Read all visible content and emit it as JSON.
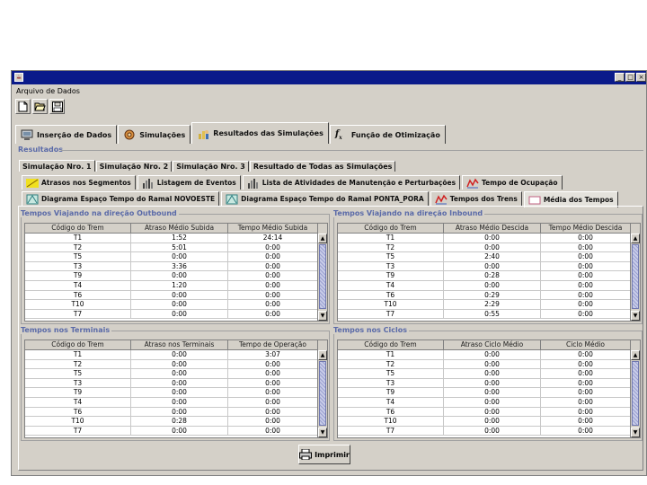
{
  "window": {
    "title": ""
  },
  "menu": {
    "items": [
      "Arquivo de Dados"
    ]
  },
  "toolbar": {
    "icons": [
      "new-file-icon",
      "open-folder-icon",
      "save-disk-icon"
    ]
  },
  "main_tabs": [
    {
      "label": "Inserção de Dados",
      "icon": "monitor-icon"
    },
    {
      "label": "Simulações",
      "icon": "gear-icon"
    },
    {
      "label": "Resultados das Simulações",
      "icon": "people-chart-icon",
      "active": true
    },
    {
      "label": "Função de Otimização",
      "icon": "function-icon"
    }
  ],
  "results_section": "Resultados",
  "sim_tabs": [
    {
      "label": "Simulação Nro. 1",
      "active": true
    },
    {
      "label": "Simulação Nro. 2"
    },
    {
      "label": "Simulação Nro. 3"
    },
    {
      "label": "Resultado de Todas as Simulações"
    }
  ],
  "result_tabs_row1": [
    {
      "label": "Atrasos nos Segmentos",
      "icon": "segment-icon"
    },
    {
      "label": "Listagem de Eventos",
      "icon": "bars-icon"
    },
    {
      "label": "Lista de Atividades de Manutenção e Perturbações",
      "icon": "bars-icon"
    },
    {
      "label": "Tempo de Ocupação",
      "icon": "line-chart-icon"
    }
  ],
  "result_tabs_row2": [
    {
      "label": "Diagrama Espaço Tempo do Ramal NOVOESTE",
      "icon": "diagram-icon"
    },
    {
      "label": "Diagrama Espaço Tempo do Ramal PONTA_PORA",
      "icon": "diagram-icon"
    },
    {
      "label": "Tempos dos Trens",
      "icon": "line-chart-icon"
    },
    {
      "label": "Média dos Tempos",
      "icon": "blank-icon",
      "active": true
    }
  ],
  "panels": {
    "outbound": {
      "title": "Tempos Viajando na direção Outbound",
      "columns": [
        "Código do Trem",
        "Atraso Médio Subida",
        "Tempo Médio Subida"
      ],
      "rows": [
        [
          "T1",
          "1:52",
          "24:14"
        ],
        [
          "T2",
          "5:01",
          "0:00"
        ],
        [
          "T5",
          "0:00",
          "0:00"
        ],
        [
          "T3",
          "3:36",
          "0:00"
        ],
        [
          "T9",
          "0:00",
          "0:00"
        ],
        [
          "T4",
          "1:20",
          "0:00"
        ],
        [
          "T6",
          "0:00",
          "0:00"
        ],
        [
          "T10",
          "0:00",
          "0:00"
        ],
        [
          "T7",
          "0:00",
          "0:00"
        ]
      ]
    },
    "inbound": {
      "title": "Tempos Viajando na direção Inbound",
      "columns": [
        "Código do Trem",
        "Atraso Médio Descida",
        "Tempo Médio Descida"
      ],
      "rows": [
        [
          "T1",
          "0:00",
          "0:00"
        ],
        [
          "T2",
          "0:00",
          "0:00"
        ],
        [
          "T5",
          "2:40",
          "0:00"
        ],
        [
          "T3",
          "0:00",
          "0:00"
        ],
        [
          "T9",
          "0:28",
          "0:00"
        ],
        [
          "T4",
          "0:00",
          "0:00"
        ],
        [
          "T6",
          "0:29",
          "0:00"
        ],
        [
          "T10",
          "2:29",
          "0:00"
        ],
        [
          "T7",
          "0:55",
          "0:00"
        ]
      ]
    },
    "terminals": {
      "title": "Tempos nos Terminais",
      "columns": [
        "Código do Trem",
        "Atraso nos Terminais",
        "Tempo de Operação"
      ],
      "rows": [
        [
          "T1",
          "0:00",
          "3:07"
        ],
        [
          "T2",
          "0:00",
          "0:00"
        ],
        [
          "T5",
          "0:00",
          "0:00"
        ],
        [
          "T3",
          "0:00",
          "0:00"
        ],
        [
          "T9",
          "0:00",
          "0:00"
        ],
        [
          "T4",
          "0:00",
          "0:00"
        ],
        [
          "T6",
          "0:00",
          "0:00"
        ],
        [
          "T10",
          "0:28",
          "0:00"
        ],
        [
          "T7",
          "0:00",
          "0:00"
        ]
      ]
    },
    "cycles": {
      "title": "Tempos nos Ciclos",
      "columns": [
        "Código do Trem",
        "Atraso Ciclo Médio",
        "Ciclo Médio"
      ],
      "rows": [
        [
          "T1",
          "0:00",
          "0:00"
        ],
        [
          "T2",
          "0:00",
          "0:00"
        ],
        [
          "T5",
          "0:00",
          "0:00"
        ],
        [
          "T3",
          "0:00",
          "0:00"
        ],
        [
          "T9",
          "0:00",
          "0:00"
        ],
        [
          "T4",
          "0:00",
          "0:00"
        ],
        [
          "T6",
          "0:00",
          "0:00"
        ],
        [
          "T10",
          "0:00",
          "0:00"
        ],
        [
          "T7",
          "0:00",
          "0:00"
        ]
      ]
    }
  },
  "print_button": {
    "label": "Imprimir",
    "icon": "printer-icon"
  },
  "colors": {
    "titlebar": "#0a1a8a",
    "section_title": "#5a6aa8",
    "window_bg": "#d4d0c8"
  }
}
